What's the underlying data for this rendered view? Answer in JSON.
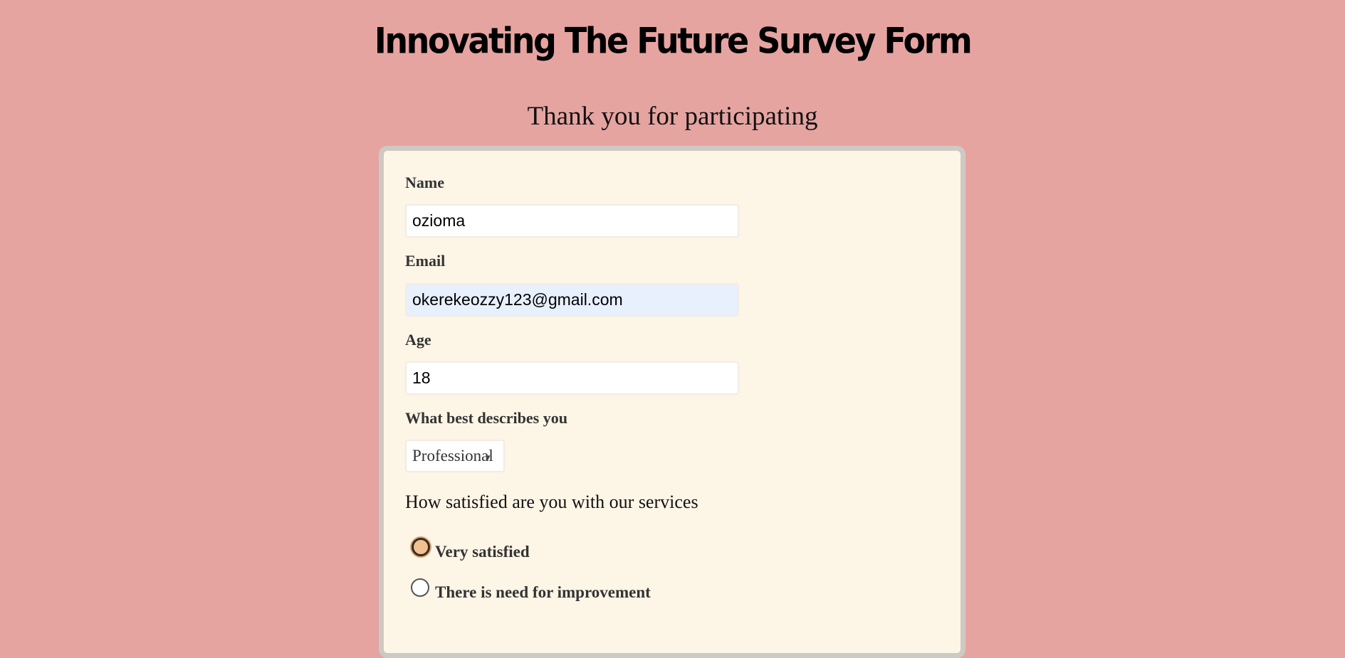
{
  "header": {
    "title": "Innovating The Future Survey Form",
    "subtitle": "Thank you for participating"
  },
  "form": {
    "name": {
      "label": "Name",
      "value": "ozioma"
    },
    "email": {
      "label": "Email",
      "value": "okerekeozzy123@gmail.com"
    },
    "age": {
      "label": "Age",
      "value": "18"
    },
    "role": {
      "label": "What best describes you",
      "selected": "Professional",
      "icon": "chevron-down-icon"
    },
    "satisfaction": {
      "question": "How satisfied are you with our services",
      "options": [
        {
          "label": "Very satisfied",
          "checked": true
        },
        {
          "label": "There is need for improvement",
          "checked": false
        }
      ]
    }
  },
  "colors": {
    "page_background": "#e6a4a1",
    "card_background": "#fdf5e6",
    "card_border": "#cfc9c4",
    "autofill_background": "#e8f0fe",
    "radio_checked_fill": "#f0c090"
  }
}
